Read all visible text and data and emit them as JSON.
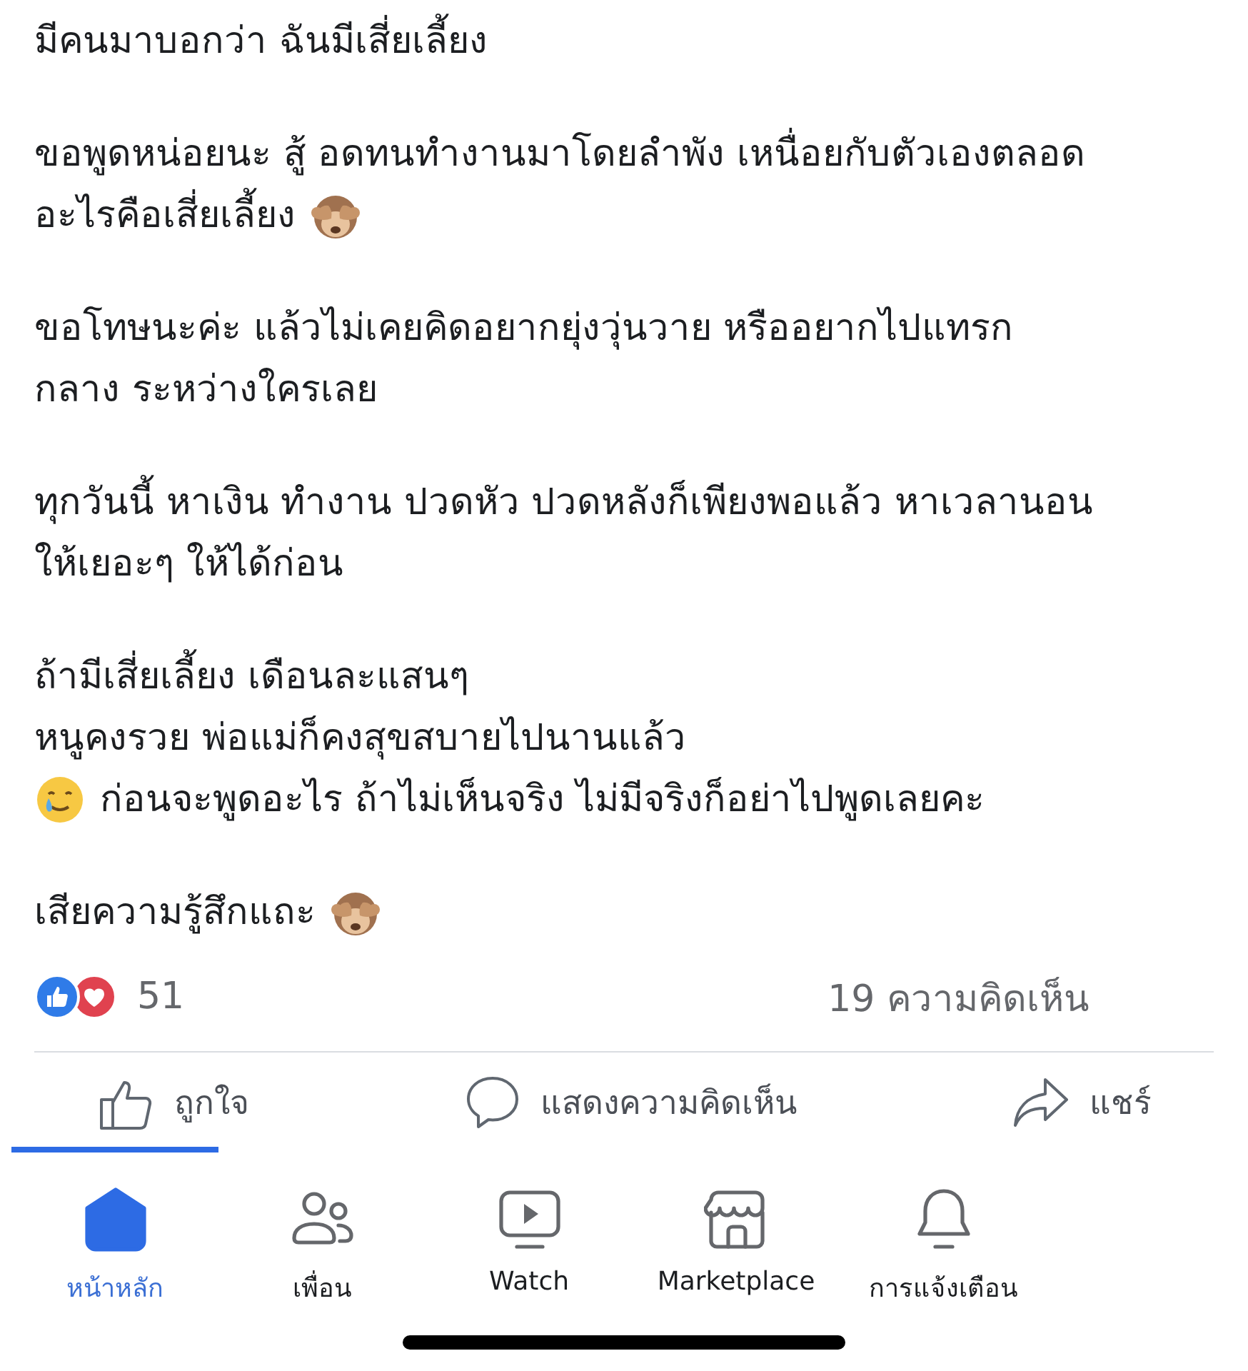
{
  "post": {
    "paragraphs": [
      {
        "lines": [
          {
            "text": "มีคนมาบอกว่า ฉันมีเสี่ยเลี้ยง"
          }
        ]
      },
      {
        "lines": [
          {
            "text": "ขอพูดหน่อยนะ สู้ อดทนทำงานมาโดยลำพัง เหนื่อยกับตัวเองตลอด"
          },
          {
            "text": "อะไรคือเสี่ยเลี้ยง",
            "trailing_icon": {
              "kind": "monkey"
            }
          }
        ]
      },
      {
        "lines": [
          {
            "text": "ขอโทษนะค่ะ แล้วไม่เคยคิดอยากยุ่งวุ่นวาย หรืออยากไปแทรก"
          },
          {
            "text": "กลาง ระหว่างใครเลย"
          }
        ]
      },
      {
        "lines": [
          {
            "text": "ทุกวันนี้ หาเงิน ทำงาน ปวดหัว ปวดหลังก็เพียงพอแล้ว หาเวลานอน"
          },
          {
            "text": "ให้เยอะๆ ให้ได้ก่อน"
          }
        ]
      },
      {
        "lines": [
          {
            "text": "ถ้ามีเสี่ยเลี้ยง เดือนละแสนๆ"
          },
          {
            "text": "หนูคงรวย พ่อแม่ก็คงสุขสบายไปนานแล้ว"
          },
          {
            "text": "ก่อนจะพูดอะไร ถ้าไม่เห็นจริง ไม่มีจริงก็อย่าไปพูดเลยคะ",
            "leading_icon": {
              "kind": "tearsmile"
            }
          }
        ]
      },
      {
        "lines": [
          {
            "text": "เสียความรู้สึกแถะ",
            "trailing_icon": {
              "kind": "monkey"
            }
          }
        ]
      }
    ]
  },
  "reactions": {
    "icons": [
      {
        "kind": "like"
      },
      {
        "kind": "love"
      }
    ],
    "count": "51",
    "comments": "19 ความคิดเห็น"
  },
  "actions": [
    {
      "kind": "like",
      "label": "ถูกใจ"
    },
    {
      "kind": "comment",
      "label": "แสดงความคิดเห็น"
    },
    {
      "kind": "share",
      "label": "แชร์"
    }
  ],
  "nav": [
    {
      "kind": "home",
      "label": "หน้าหลัก",
      "selected": true
    },
    {
      "kind": "friends",
      "label": "เพื่อน",
      "selected": false
    },
    {
      "kind": "watch",
      "label": "Watch",
      "selected": false
    },
    {
      "kind": "marketplace",
      "label": "Marketplace",
      "selected": false
    },
    {
      "kind": "notifications",
      "label": "การแจ้งเตือน",
      "selected": false
    }
  ]
}
